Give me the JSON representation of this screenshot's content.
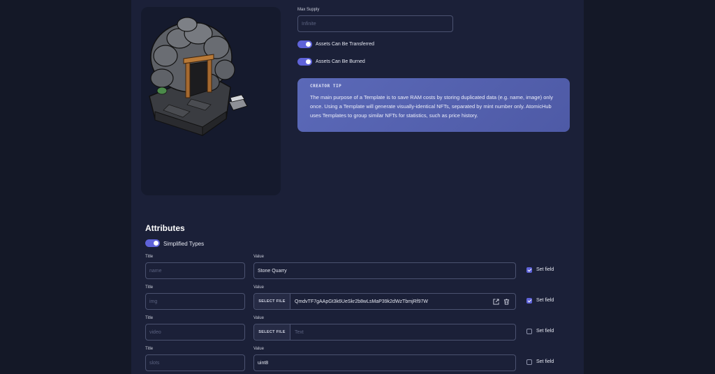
{
  "template": {
    "max_supply_label": "Max Supply",
    "max_supply_placeholder": "Infinite",
    "transferable_label": "Assets Can Be Transferred",
    "transferable_on": true,
    "burnable_label": "Assets Can Be Burned",
    "burnable_on": true
  },
  "tip": {
    "title": "CREATOR TIP",
    "text": "The main purpose of a Template is to save RAM costs by storing duplicated data (e.g. name, image) only once. Using a Template will generate visually-identical NFTs, separated by mint number only. AtomicHub uses Templates to group similar NFTs for statistics, such as price history."
  },
  "attributes": {
    "title": "Attributes",
    "simplified_label": "Simplified Types",
    "simplified_on": true,
    "title_col": "Title",
    "value_col": "Value",
    "select_file": "SELECT FILE",
    "set_field": "Set field",
    "rows": [
      {
        "title_placeholder": "name",
        "value": "Stone Quarry",
        "type": "text",
        "checked": true
      },
      {
        "title_placeholder": "img",
        "value": "QmdvTF7gAApGt3k6UeSkr2b8wLsMaP39k2dWzTbmjRf97W",
        "type": "file",
        "checked": true
      },
      {
        "title_placeholder": "video",
        "value": "Text",
        "type": "file-empty",
        "checked": false
      },
      {
        "title_placeholder": "slots",
        "value": "uint8",
        "type": "text",
        "checked": false
      }
    ]
  },
  "colors": {
    "accent": "#5f63d9",
    "panel": "#1b2038",
    "background": "#141827",
    "tip_gradient": "#5b69b8"
  }
}
